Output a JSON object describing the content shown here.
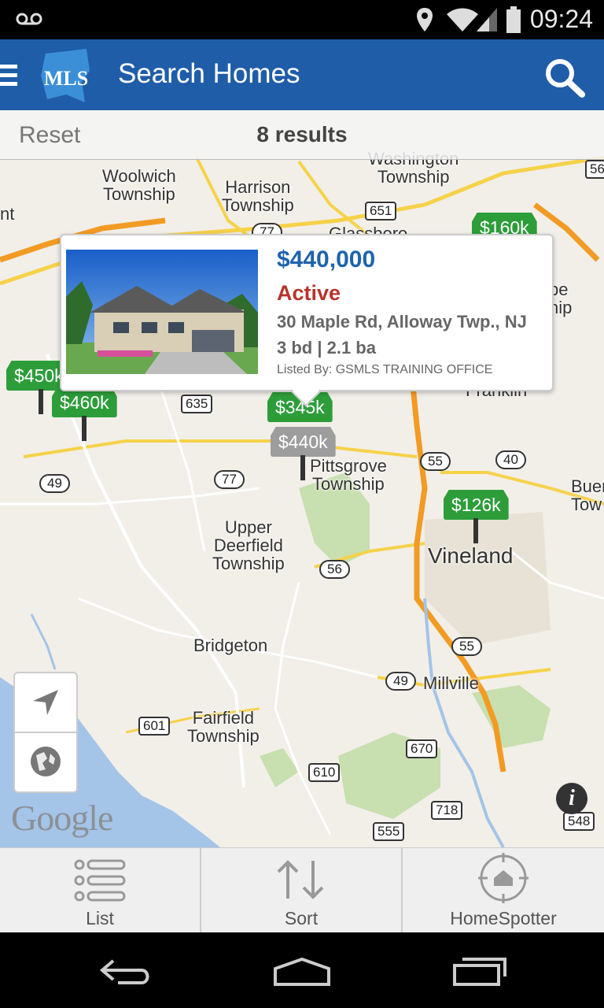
{
  "status_bar": {
    "time": "09:24",
    "icons": [
      "voicemail-icon",
      "location-icon",
      "wifi-icon",
      "signal-icon",
      "battery-icon"
    ]
  },
  "app_bar": {
    "title": "Search Homes",
    "logo_text": "MLS",
    "icons": [
      "menu-icon",
      "search-icon"
    ],
    "color": "#1f5da8"
  },
  "results_bar": {
    "reset_label": "Reset",
    "count_label": "8 results"
  },
  "map": {
    "places": [
      {
        "name": "Woolwich\nTownship"
      },
      {
        "name": "Harrison\nTownship"
      },
      {
        "name": "Washington\nTownship"
      },
      {
        "name": "Glassboro"
      },
      {
        "name": "Pittsgrove\nTownship"
      },
      {
        "name": "Upper\nDeerfield\nTownship"
      },
      {
        "name": "Vineland"
      },
      {
        "name": "Bridgeton"
      },
      {
        "name": "Millville"
      },
      {
        "name": "Fairfield\nTownship"
      },
      {
        "name": "Franklin"
      },
      {
        "name": "nt"
      },
      {
        "name": "Buen\nTow"
      },
      {
        "name": "pe\nhip"
      }
    ],
    "road_shields": [
      "651",
      "77",
      "635",
      "77",
      "55",
      "40",
      "49",
      "56",
      "55",
      "49",
      "601",
      "670",
      "610",
      "718",
      "555",
      "548",
      "56"
    ],
    "pins": [
      {
        "label": "$450k",
        "color": "#2d9d3a"
      },
      {
        "label": "$460k",
        "color": "#2d9d3a"
      },
      {
        "label": "$345k",
        "color": "#2d9d3a"
      },
      {
        "label": "$440k",
        "color": "#9d9d9d"
      },
      {
        "label": "$126k",
        "color": "#2d9d3a"
      },
      {
        "label": "$160k",
        "color": "#2d9d3a"
      }
    ],
    "attribution": "Google"
  },
  "popup": {
    "price": "$440,000",
    "status": "Active",
    "address": "30 Maple Rd, Alloway Twp., NJ",
    "beds_baths": "3 bd | 2.1 ba",
    "listed_by": "Listed By: GSMLS TRAINING OFFICE",
    "price_color": "#1f63ad",
    "status_color": "#b7332b"
  },
  "map_controls": [
    "navigate-arrow-icon",
    "globe-icon",
    "info-icon"
  ],
  "bottom_tabs": [
    {
      "label": "List",
      "icon": "list-icon"
    },
    {
      "label": "Sort",
      "icon": "sort-arrows-icon"
    },
    {
      "label": "HomeSpotter",
      "icon": "homespotter-target-icon"
    }
  ],
  "nav_bar": [
    "back-icon",
    "home-icon",
    "recents-icon"
  ]
}
